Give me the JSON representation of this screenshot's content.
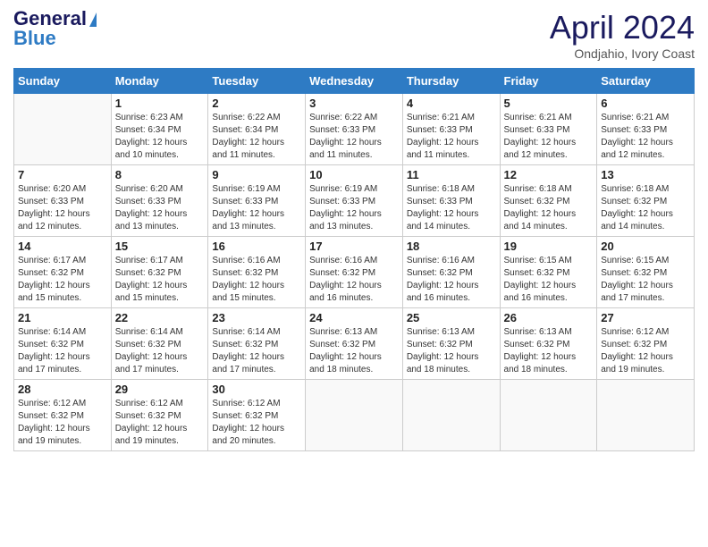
{
  "header": {
    "logo_line1": "General",
    "logo_line2": "Blue",
    "title": "April 2024",
    "location": "Ondjahio, Ivory Coast"
  },
  "days_of_week": [
    "Sunday",
    "Monday",
    "Tuesday",
    "Wednesday",
    "Thursday",
    "Friday",
    "Saturday"
  ],
  "weeks": [
    [
      {
        "num": "",
        "info": ""
      },
      {
        "num": "1",
        "info": "Sunrise: 6:23 AM\nSunset: 6:34 PM\nDaylight: 12 hours\nand 10 minutes."
      },
      {
        "num": "2",
        "info": "Sunrise: 6:22 AM\nSunset: 6:34 PM\nDaylight: 12 hours\nand 11 minutes."
      },
      {
        "num": "3",
        "info": "Sunrise: 6:22 AM\nSunset: 6:33 PM\nDaylight: 12 hours\nand 11 minutes."
      },
      {
        "num": "4",
        "info": "Sunrise: 6:21 AM\nSunset: 6:33 PM\nDaylight: 12 hours\nand 11 minutes."
      },
      {
        "num": "5",
        "info": "Sunrise: 6:21 AM\nSunset: 6:33 PM\nDaylight: 12 hours\nand 12 minutes."
      },
      {
        "num": "6",
        "info": "Sunrise: 6:21 AM\nSunset: 6:33 PM\nDaylight: 12 hours\nand 12 minutes."
      }
    ],
    [
      {
        "num": "7",
        "info": "Sunrise: 6:20 AM\nSunset: 6:33 PM\nDaylight: 12 hours\nand 12 minutes."
      },
      {
        "num": "8",
        "info": "Sunrise: 6:20 AM\nSunset: 6:33 PM\nDaylight: 12 hours\nand 13 minutes."
      },
      {
        "num": "9",
        "info": "Sunrise: 6:19 AM\nSunset: 6:33 PM\nDaylight: 12 hours\nand 13 minutes."
      },
      {
        "num": "10",
        "info": "Sunrise: 6:19 AM\nSunset: 6:33 PM\nDaylight: 12 hours\nand 13 minutes."
      },
      {
        "num": "11",
        "info": "Sunrise: 6:18 AM\nSunset: 6:33 PM\nDaylight: 12 hours\nand 14 minutes."
      },
      {
        "num": "12",
        "info": "Sunrise: 6:18 AM\nSunset: 6:32 PM\nDaylight: 12 hours\nand 14 minutes."
      },
      {
        "num": "13",
        "info": "Sunrise: 6:18 AM\nSunset: 6:32 PM\nDaylight: 12 hours\nand 14 minutes."
      }
    ],
    [
      {
        "num": "14",
        "info": "Sunrise: 6:17 AM\nSunset: 6:32 PM\nDaylight: 12 hours\nand 15 minutes."
      },
      {
        "num": "15",
        "info": "Sunrise: 6:17 AM\nSunset: 6:32 PM\nDaylight: 12 hours\nand 15 minutes."
      },
      {
        "num": "16",
        "info": "Sunrise: 6:16 AM\nSunset: 6:32 PM\nDaylight: 12 hours\nand 15 minutes."
      },
      {
        "num": "17",
        "info": "Sunrise: 6:16 AM\nSunset: 6:32 PM\nDaylight: 12 hours\nand 16 minutes."
      },
      {
        "num": "18",
        "info": "Sunrise: 6:16 AM\nSunset: 6:32 PM\nDaylight: 12 hours\nand 16 minutes."
      },
      {
        "num": "19",
        "info": "Sunrise: 6:15 AM\nSunset: 6:32 PM\nDaylight: 12 hours\nand 16 minutes."
      },
      {
        "num": "20",
        "info": "Sunrise: 6:15 AM\nSunset: 6:32 PM\nDaylight: 12 hours\nand 17 minutes."
      }
    ],
    [
      {
        "num": "21",
        "info": "Sunrise: 6:14 AM\nSunset: 6:32 PM\nDaylight: 12 hours\nand 17 minutes."
      },
      {
        "num": "22",
        "info": "Sunrise: 6:14 AM\nSunset: 6:32 PM\nDaylight: 12 hours\nand 17 minutes."
      },
      {
        "num": "23",
        "info": "Sunrise: 6:14 AM\nSunset: 6:32 PM\nDaylight: 12 hours\nand 17 minutes."
      },
      {
        "num": "24",
        "info": "Sunrise: 6:13 AM\nSunset: 6:32 PM\nDaylight: 12 hours\nand 18 minutes."
      },
      {
        "num": "25",
        "info": "Sunrise: 6:13 AM\nSunset: 6:32 PM\nDaylight: 12 hours\nand 18 minutes."
      },
      {
        "num": "26",
        "info": "Sunrise: 6:13 AM\nSunset: 6:32 PM\nDaylight: 12 hours\nand 18 minutes."
      },
      {
        "num": "27",
        "info": "Sunrise: 6:12 AM\nSunset: 6:32 PM\nDaylight: 12 hours\nand 19 minutes."
      }
    ],
    [
      {
        "num": "28",
        "info": "Sunrise: 6:12 AM\nSunset: 6:32 PM\nDaylight: 12 hours\nand 19 minutes."
      },
      {
        "num": "29",
        "info": "Sunrise: 6:12 AM\nSunset: 6:32 PM\nDaylight: 12 hours\nand 19 minutes."
      },
      {
        "num": "30",
        "info": "Sunrise: 6:12 AM\nSunset: 6:32 PM\nDaylight: 12 hours\nand 20 minutes."
      },
      {
        "num": "",
        "info": ""
      },
      {
        "num": "",
        "info": ""
      },
      {
        "num": "",
        "info": ""
      },
      {
        "num": "",
        "info": ""
      }
    ]
  ]
}
